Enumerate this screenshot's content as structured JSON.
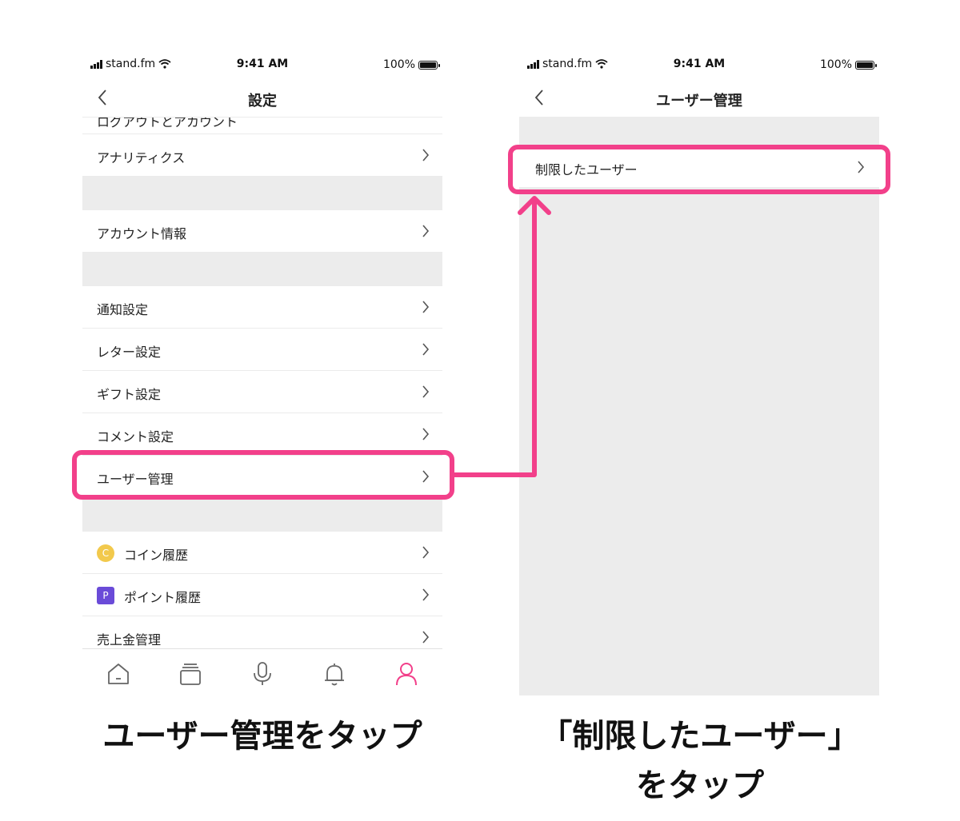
{
  "status": {
    "carrier": "stand.fm",
    "time": "9:41 AM",
    "battery": "100%"
  },
  "left_screen": {
    "title": "設定",
    "partial_row": "ログアウトとアカウント",
    "rows_group1": [
      "アナリティクス"
    ],
    "rows_group2": [
      "アカウント情報"
    ],
    "rows_group3": [
      "通知設定",
      "レター設定",
      "ギフト設定",
      "コメント設定",
      "ユーザー管理"
    ],
    "rows_group4": [
      {
        "label": "コイン履歴",
        "badge": "C",
        "badge_color": "#f2c94c"
      },
      {
        "label": "ポイント履歴",
        "badge": "P",
        "badge_color": "#6a4bd8"
      },
      {
        "label": "売上金管理"
      }
    ],
    "tabs": [
      "home-icon",
      "library-icon",
      "microphone-icon",
      "bell-icon",
      "profile-icon"
    ],
    "active_tab": "profile-icon"
  },
  "right_screen": {
    "title": "ユーザー管理",
    "rows": [
      "制限したユーザー"
    ]
  },
  "captions": {
    "left": "ユーザー管理をタップ",
    "right_line1": "「制限したユーザー」",
    "right_line2": "をタップ"
  },
  "colors": {
    "highlight": "#f2408a",
    "section_gray": "#ececec",
    "active_tab": "#f2408a"
  }
}
